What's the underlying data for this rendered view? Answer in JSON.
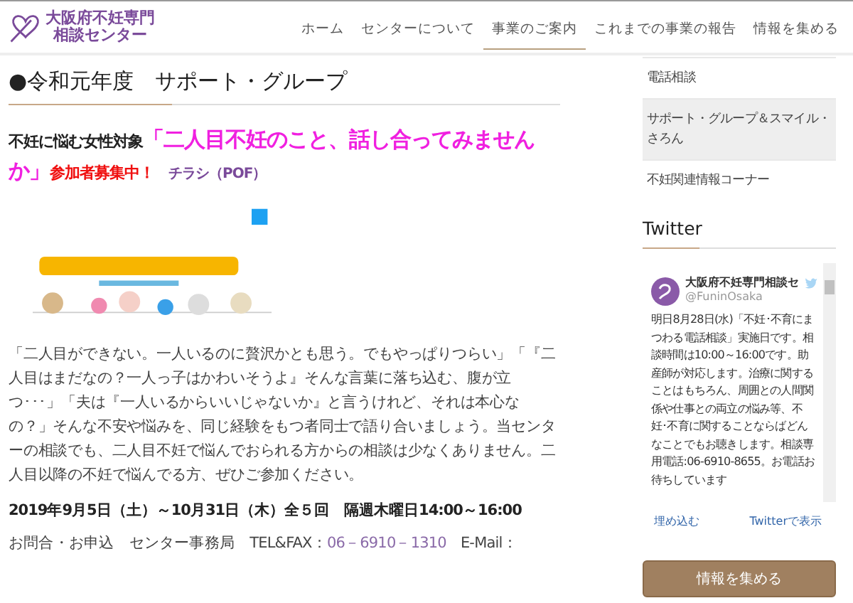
{
  "header": {
    "logo_lines": [
      "大阪府不妊専門",
      "相談センター"
    ],
    "nav": [
      {
        "label": "ホーム",
        "selected": false
      },
      {
        "label": "センターについて",
        "selected": false
      },
      {
        "label": "事業のご案内",
        "selected": true
      },
      {
        "label": "これまでの事業の報告",
        "selected": false
      },
      {
        "label": "情報を集める",
        "selected": false
      }
    ]
  },
  "page_title": "●令和元年度　サポート・グループ",
  "intro": {
    "lead": "不妊に悩む女性対象",
    "headline": "「二人目不妊のこと、話し合ってみませんか」",
    "recruit": "参加者募集中！",
    "flyer_link": "チラシ（POF）"
  },
  "body": "「二人目ができない。一人いるのに贅沢かとも思う。でもやっぱりつらい」「『二人目はまだなの？一人っ子はかわいそうよ』そんな言葉に落ち込む、腹が立つ･･･」「夫は『一人いるからいいじゃないか』と言うけれど、それは本心なの？」そんな不安や悩みを、同じ経験をもつ者同士で語り合いましょう。当センターの相談でも、二人目不妊で悩んでおられる方からの相談は少なくありません。二人目以降の不妊で悩んでる方、ぜひご参加ください。",
  "schedule": "2019年9月5日（土）～10月31日（木）全５回　隔週木曜日14:00～16:00",
  "contact": {
    "label": "お問合・お申込　センター事務局　TEL&FAX：",
    "phone": "06－6910－1310",
    "email_label": "E-Mail："
  },
  "sidebar": {
    "menu": [
      {
        "label": "電話相談",
        "selected": false
      },
      {
        "label": "サポート・グループ＆スマイル・さろん",
        "selected": true
      },
      {
        "label": "不妊関連情報コーナー",
        "selected": false
      }
    ],
    "twitter_heading": "Twitter",
    "tweet": {
      "account": "大阪府不妊専門相談セ",
      "handle": "@FuninOsaka",
      "text": "明日8月28日(水)「不妊･不育にまつわる電話相談」実施日です。相談時間は10:00～16:00です。助産師が対応します。治療に関することはもちろん、周囲との人間関係や仕事との両立の悩み等、不妊･不育に関することならばどんなことでもお聴きします。相談専用電話:06-6910-8655。お電話お待ちしています"
    },
    "widget_links": [
      "埋め込む",
      "Twitterで表示"
    ],
    "button": "情報を集める"
  }
}
